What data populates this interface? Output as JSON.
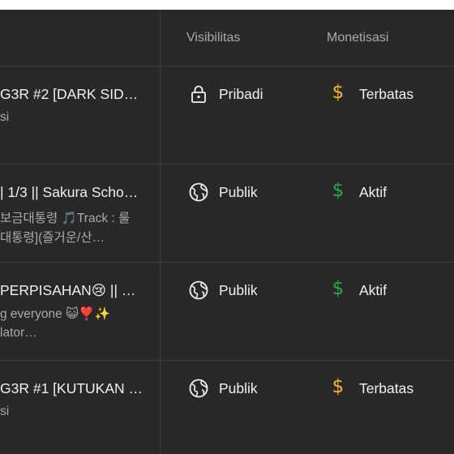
{
  "table": {
    "columns": {
      "visibility": "Visibilitas",
      "monetization": "Monetisasi"
    },
    "rows": [
      {
        "title": "G3R #2 [DARK SIDE…",
        "desc_line1": "si",
        "desc_line2": "",
        "visibility": "Pribadi",
        "visibility_icon": "lock-icon",
        "monetization": "Terbatas",
        "monetization_icon": "dollar-icon",
        "monetization_color": "#f9b233"
      },
      {
        "title": "| 1/3 || Sakura Scho…",
        "desc_line1": "보금대통령 🎵Track : 룰",
        "desc_line2": "대통령](즐거운/산…",
        "visibility": "Publik",
        "visibility_icon": "globe-icon",
        "monetization": "Aktif",
        "monetization_icon": "dollar-icon",
        "monetization_color": "#2ba640"
      },
      {
        "title": "PERPISAHAN😢 || …",
        "desc_line1": "g everyone 😺❣️✨",
        "desc_line2": "lator…",
        "visibility": "Publik",
        "visibility_icon": "globe-icon",
        "monetization": "Aktif",
        "monetization_icon": "dollar-icon",
        "monetization_color": "#2ba640"
      },
      {
        "title": "G3R #1 [KUTUKAN …",
        "desc_line1": "si",
        "desc_line2": "",
        "visibility": "Publik",
        "visibility_icon": "globe-icon",
        "monetization": "Terbatas",
        "monetization_icon": "dollar-icon",
        "monetization_color": "#f9b233"
      }
    ]
  }
}
